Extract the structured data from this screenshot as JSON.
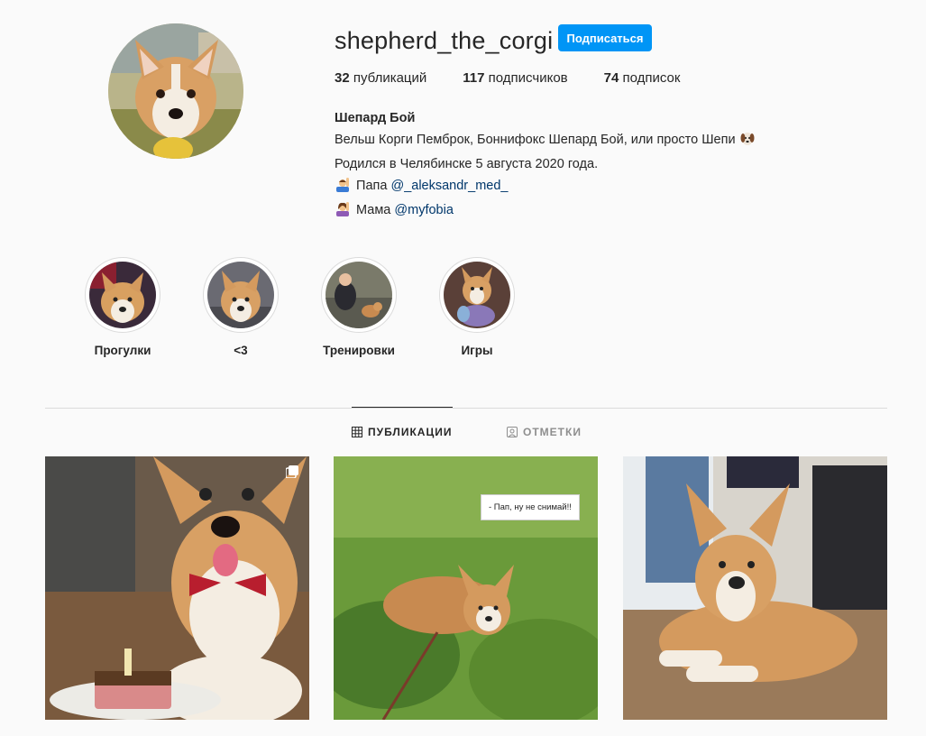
{
  "profile": {
    "username": "shepherd_the_corgi",
    "follow_label": "Подписаться",
    "stats": {
      "posts_count": "32",
      "posts_label": "публикаций",
      "followers_count": "117",
      "followers_label": "подписчиков",
      "following_count": "74",
      "following_label": "подписок"
    },
    "bio": {
      "name": "Шепард Бой",
      "line1": "Вельш Корги Пемброк, Боннифокс Шепард Бой, или просто Шепи",
      "line2": "Родился в Челябинске 5 августа 2020 года.",
      "dad_prefix": "Папа",
      "dad_link": "@_aleksandr_med_",
      "mom_prefix": "Мама",
      "mom_link": "@myfobia"
    }
  },
  "highlights": [
    {
      "label": "Прогулки"
    },
    {
      "label": "<3"
    },
    {
      "label": "Тренировки"
    },
    {
      "label": "Игры"
    }
  ],
  "tabs": {
    "posts": "ПУБЛИКАЦИИ",
    "tagged": "ОТМЕТКИ"
  },
  "posts": [
    {
      "icon": "multi-post-icon"
    },
    {
      "caption": "- Пап, ну не снимай!!"
    },
    {}
  ],
  "colors": {
    "accent": "#0095f6",
    "link": "#00376b",
    "background": "#fafafa"
  }
}
